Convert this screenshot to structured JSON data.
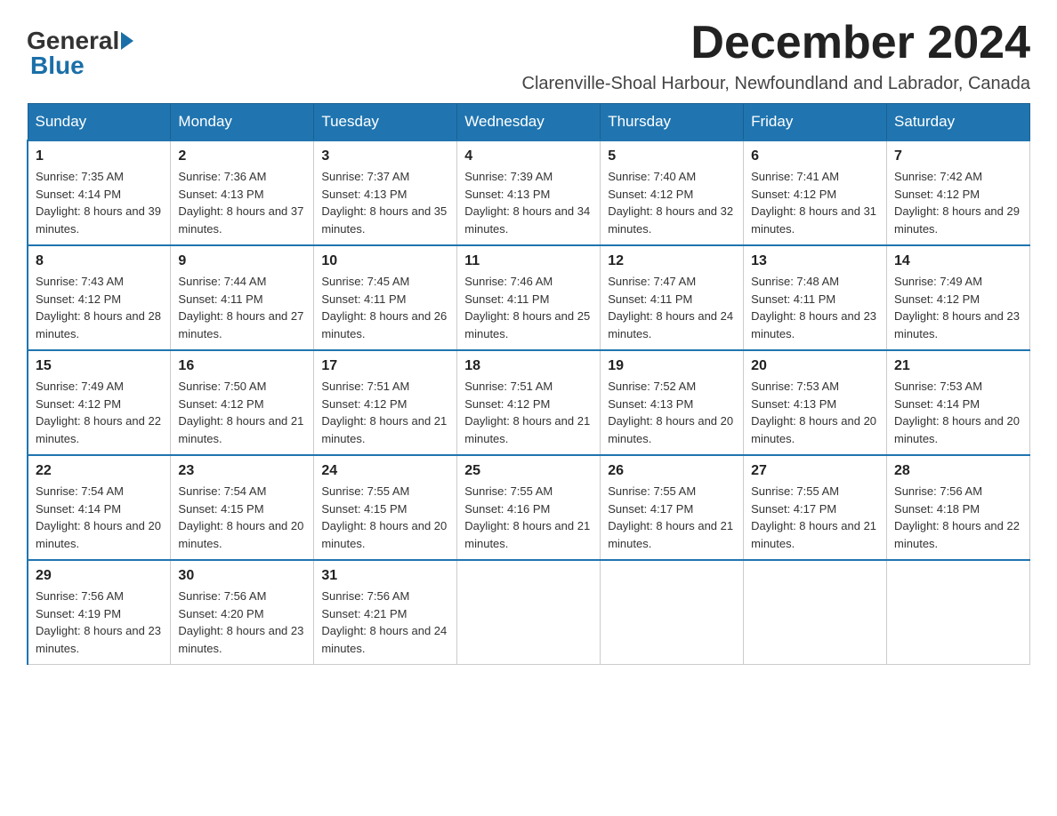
{
  "header": {
    "logo": {
      "general": "General",
      "blue": "Blue"
    },
    "title": "December 2024",
    "location": "Clarenville-Shoal Harbour, Newfoundland and Labrador, Canada"
  },
  "calendar": {
    "days_of_week": [
      "Sunday",
      "Monday",
      "Tuesday",
      "Wednesday",
      "Thursday",
      "Friday",
      "Saturday"
    ],
    "weeks": [
      [
        {
          "day": "1",
          "sunrise": "Sunrise: 7:35 AM",
          "sunset": "Sunset: 4:14 PM",
          "daylight": "Daylight: 8 hours and 39 minutes."
        },
        {
          "day": "2",
          "sunrise": "Sunrise: 7:36 AM",
          "sunset": "Sunset: 4:13 PM",
          "daylight": "Daylight: 8 hours and 37 minutes."
        },
        {
          "day": "3",
          "sunrise": "Sunrise: 7:37 AM",
          "sunset": "Sunset: 4:13 PM",
          "daylight": "Daylight: 8 hours and 35 minutes."
        },
        {
          "day": "4",
          "sunrise": "Sunrise: 7:39 AM",
          "sunset": "Sunset: 4:13 PM",
          "daylight": "Daylight: 8 hours and 34 minutes."
        },
        {
          "day": "5",
          "sunrise": "Sunrise: 7:40 AM",
          "sunset": "Sunset: 4:12 PM",
          "daylight": "Daylight: 8 hours and 32 minutes."
        },
        {
          "day": "6",
          "sunrise": "Sunrise: 7:41 AM",
          "sunset": "Sunset: 4:12 PM",
          "daylight": "Daylight: 8 hours and 31 minutes."
        },
        {
          "day": "7",
          "sunrise": "Sunrise: 7:42 AM",
          "sunset": "Sunset: 4:12 PM",
          "daylight": "Daylight: 8 hours and 29 minutes."
        }
      ],
      [
        {
          "day": "8",
          "sunrise": "Sunrise: 7:43 AM",
          "sunset": "Sunset: 4:12 PM",
          "daylight": "Daylight: 8 hours and 28 minutes."
        },
        {
          "day": "9",
          "sunrise": "Sunrise: 7:44 AM",
          "sunset": "Sunset: 4:11 PM",
          "daylight": "Daylight: 8 hours and 27 minutes."
        },
        {
          "day": "10",
          "sunrise": "Sunrise: 7:45 AM",
          "sunset": "Sunset: 4:11 PM",
          "daylight": "Daylight: 8 hours and 26 minutes."
        },
        {
          "day": "11",
          "sunrise": "Sunrise: 7:46 AM",
          "sunset": "Sunset: 4:11 PM",
          "daylight": "Daylight: 8 hours and 25 minutes."
        },
        {
          "day": "12",
          "sunrise": "Sunrise: 7:47 AM",
          "sunset": "Sunset: 4:11 PM",
          "daylight": "Daylight: 8 hours and 24 minutes."
        },
        {
          "day": "13",
          "sunrise": "Sunrise: 7:48 AM",
          "sunset": "Sunset: 4:11 PM",
          "daylight": "Daylight: 8 hours and 23 minutes."
        },
        {
          "day": "14",
          "sunrise": "Sunrise: 7:49 AM",
          "sunset": "Sunset: 4:12 PM",
          "daylight": "Daylight: 8 hours and 23 minutes."
        }
      ],
      [
        {
          "day": "15",
          "sunrise": "Sunrise: 7:49 AM",
          "sunset": "Sunset: 4:12 PM",
          "daylight": "Daylight: 8 hours and 22 minutes."
        },
        {
          "day": "16",
          "sunrise": "Sunrise: 7:50 AM",
          "sunset": "Sunset: 4:12 PM",
          "daylight": "Daylight: 8 hours and 21 minutes."
        },
        {
          "day": "17",
          "sunrise": "Sunrise: 7:51 AM",
          "sunset": "Sunset: 4:12 PM",
          "daylight": "Daylight: 8 hours and 21 minutes."
        },
        {
          "day": "18",
          "sunrise": "Sunrise: 7:51 AM",
          "sunset": "Sunset: 4:12 PM",
          "daylight": "Daylight: 8 hours and 21 minutes."
        },
        {
          "day": "19",
          "sunrise": "Sunrise: 7:52 AM",
          "sunset": "Sunset: 4:13 PM",
          "daylight": "Daylight: 8 hours and 20 minutes."
        },
        {
          "day": "20",
          "sunrise": "Sunrise: 7:53 AM",
          "sunset": "Sunset: 4:13 PM",
          "daylight": "Daylight: 8 hours and 20 minutes."
        },
        {
          "day": "21",
          "sunrise": "Sunrise: 7:53 AM",
          "sunset": "Sunset: 4:14 PM",
          "daylight": "Daylight: 8 hours and 20 minutes."
        }
      ],
      [
        {
          "day": "22",
          "sunrise": "Sunrise: 7:54 AM",
          "sunset": "Sunset: 4:14 PM",
          "daylight": "Daylight: 8 hours and 20 minutes."
        },
        {
          "day": "23",
          "sunrise": "Sunrise: 7:54 AM",
          "sunset": "Sunset: 4:15 PM",
          "daylight": "Daylight: 8 hours and 20 minutes."
        },
        {
          "day": "24",
          "sunrise": "Sunrise: 7:55 AM",
          "sunset": "Sunset: 4:15 PM",
          "daylight": "Daylight: 8 hours and 20 minutes."
        },
        {
          "day": "25",
          "sunrise": "Sunrise: 7:55 AM",
          "sunset": "Sunset: 4:16 PM",
          "daylight": "Daylight: 8 hours and 21 minutes."
        },
        {
          "day": "26",
          "sunrise": "Sunrise: 7:55 AM",
          "sunset": "Sunset: 4:17 PM",
          "daylight": "Daylight: 8 hours and 21 minutes."
        },
        {
          "day": "27",
          "sunrise": "Sunrise: 7:55 AM",
          "sunset": "Sunset: 4:17 PM",
          "daylight": "Daylight: 8 hours and 21 minutes."
        },
        {
          "day": "28",
          "sunrise": "Sunrise: 7:56 AM",
          "sunset": "Sunset: 4:18 PM",
          "daylight": "Daylight: 8 hours and 22 minutes."
        }
      ],
      [
        {
          "day": "29",
          "sunrise": "Sunrise: 7:56 AM",
          "sunset": "Sunset: 4:19 PM",
          "daylight": "Daylight: 8 hours and 23 minutes."
        },
        {
          "day": "30",
          "sunrise": "Sunrise: 7:56 AM",
          "sunset": "Sunset: 4:20 PM",
          "daylight": "Daylight: 8 hours and 23 minutes."
        },
        {
          "day": "31",
          "sunrise": "Sunrise: 7:56 AM",
          "sunset": "Sunset: 4:21 PM",
          "daylight": "Daylight: 8 hours and 24 minutes."
        },
        null,
        null,
        null,
        null
      ]
    ]
  }
}
